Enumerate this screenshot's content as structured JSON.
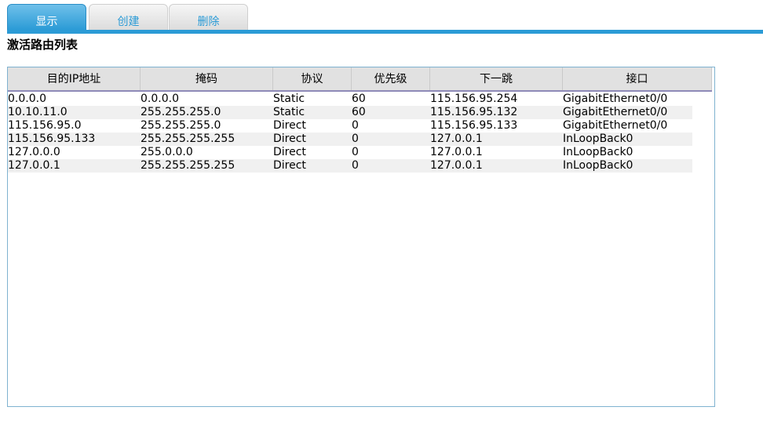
{
  "tabs": [
    {
      "label": "显示",
      "active": true
    },
    {
      "label": "创建",
      "active": false
    },
    {
      "label": "删除",
      "active": false
    }
  ],
  "page_title": "激活路由列表",
  "table": {
    "columns": [
      "目的IP地址",
      "掩码",
      "协议",
      "优先级",
      "下一跳",
      "接口"
    ],
    "rows": [
      [
        "0.0.0.0",
        "0.0.0.0",
        "Static",
        "60",
        "115.156.95.254",
        "GigabitEthernet0/0"
      ],
      [
        "10.10.11.0",
        "255.255.255.0",
        "Static",
        "60",
        "115.156.95.132",
        "GigabitEthernet0/0"
      ],
      [
        "115.156.95.0",
        "255.255.255.0",
        "Direct",
        "0",
        "115.156.95.133",
        "GigabitEthernet0/0"
      ],
      [
        "115.156.95.133",
        "255.255.255.255",
        "Direct",
        "0",
        "127.0.0.1",
        "InLoopBack0"
      ],
      [
        "127.0.0.0",
        "255.0.0.0",
        "Direct",
        "0",
        "127.0.0.1",
        "InLoopBack0"
      ],
      [
        "127.0.0.1",
        "255.255.255.255",
        "Direct",
        "0",
        "127.0.0.1",
        "InLoopBack0"
      ]
    ]
  },
  "colors": {
    "accent": "#2b9bd6",
    "header_bg": "#e1e1e1",
    "alt_row": "#f0f0f0"
  }
}
